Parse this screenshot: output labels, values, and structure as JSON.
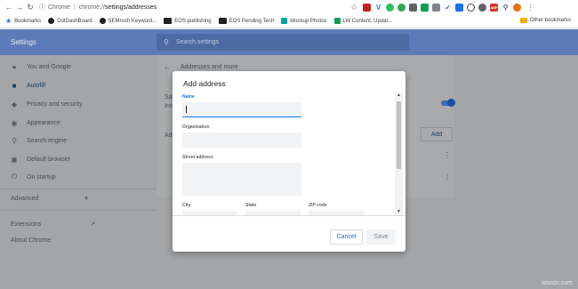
{
  "browser": {
    "url_chip": "Chrome",
    "url_host": "chrome://",
    "url_path": "settings/addresses",
    "back_icon": "arrow-left",
    "forward_icon": "arrow-right",
    "reload_icon": "reload",
    "star_icon": "star",
    "menu_icon": "vertical-dots",
    "extensions": [
      {
        "name": "ext-red-badge",
        "label": "",
        "color": "#c5221f"
      },
      {
        "name": "ext-v",
        "label": "V",
        "color": "#1e88e5"
      },
      {
        "name": "ext-evernote",
        "label": "",
        "color": "#2dbe60"
      },
      {
        "name": "ext-green-round",
        "label": "",
        "color": "#34a853"
      },
      {
        "name": "ext-mail",
        "label": "",
        "color": "#5f6368"
      },
      {
        "name": "ext-sheets",
        "label": "",
        "color": "#0f9d58"
      },
      {
        "name": "ext-gray",
        "label": "",
        "color": "#80868b"
      },
      {
        "name": "ext-dropper",
        "label": "",
        "color": "#5f6368"
      },
      {
        "name": "ext-blue",
        "label": "",
        "color": "#1a73e8"
      },
      {
        "name": "ext-circle",
        "label": "",
        "color": "#3c4043"
      },
      {
        "name": "ext-gear",
        "label": "",
        "color": "#5f6368"
      },
      {
        "name": "ext-abp",
        "label": "ABP",
        "color": "#d93025"
      },
      {
        "name": "ext-key",
        "label": "",
        "color": "#5f6368"
      },
      {
        "name": "ext-avatar",
        "label": "",
        "color": "#e37400"
      }
    ]
  },
  "bookmarks": {
    "items": [
      {
        "label": "Bookmarks",
        "color": "#1a73e8"
      },
      {
        "label": "DotDashBoard",
        "color": "#202124"
      },
      {
        "label": "SEMrush Keyword...",
        "color": "#202124"
      },
      {
        "label": "EOS publishing",
        "color": "#202124"
      },
      {
        "label": "EOS Pending Tech",
        "color": "#202124"
      },
      {
        "label": "Mockup Photos",
        "color": "#00a2a8"
      },
      {
        "label": "LW Content, Updat...",
        "color": "#0f9d58"
      }
    ],
    "other": "Other bookmarks"
  },
  "settings": {
    "title": "Settings",
    "search_placeholder": "Search settings"
  },
  "sidebar": {
    "items": [
      {
        "label": "You and Google",
        "icon": "person-icon"
      },
      {
        "label": "Autofill",
        "icon": "clipboard-icon"
      },
      {
        "label": "Privacy and security",
        "icon": "shield-icon"
      },
      {
        "label": "Appearance",
        "icon": "palette-icon"
      },
      {
        "label": "Search engine",
        "icon": "search-icon"
      },
      {
        "label": "Default browser",
        "icon": "browser-icon"
      },
      {
        "label": "On startup",
        "icon": "power-icon"
      }
    ],
    "advanced": "Advanced",
    "extensions": "Extensions",
    "about": "About Chrome"
  },
  "main": {
    "page_title": "Addresses and more",
    "save_label_partial": "Sav",
    "include_partial": "Inc",
    "add_partial": "Add",
    "add_button": "Add"
  },
  "dialog": {
    "title": "Add address",
    "fields": {
      "name": "Name",
      "organization": "Organization",
      "street": "Street address",
      "city": "City",
      "state": "State",
      "zip": "ZIP code"
    },
    "cancel": "Cancel",
    "save": "Save"
  },
  "watermark": "wsxdn.com"
}
